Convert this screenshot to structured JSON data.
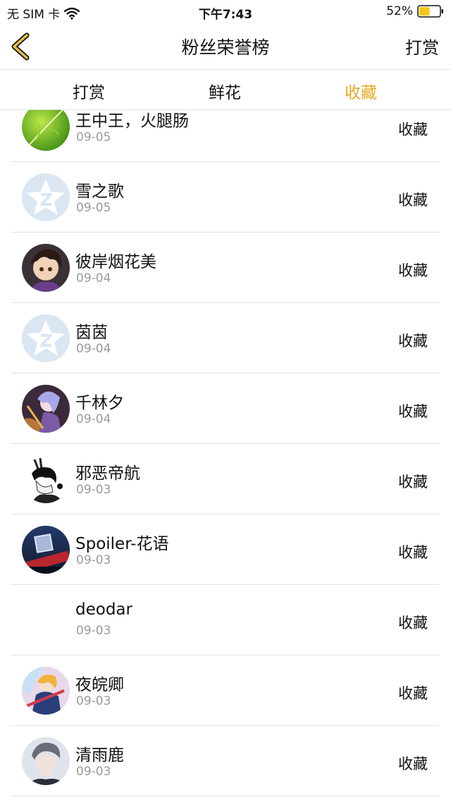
{
  "status_bar": {
    "carrier": "无 SIM 卡",
    "time": "下午7:43",
    "battery": "52%",
    "battery_level": 0.52,
    "battery_color": "#f5c518"
  },
  "nav": {
    "back_icon": "chevron-left-icon",
    "title": "粉丝荣誉榜",
    "action": "打赏",
    "accent_color": "#e6a823"
  },
  "tabs": [
    {
      "label": "打赏",
      "active": false
    },
    {
      "label": "鲜花",
      "active": false
    },
    {
      "label": "收藏",
      "active": true
    }
  ],
  "active_tab_color": "#e6a823",
  "entries": [
    {
      "name": "王中王，火腿肠",
      "date": "09-05",
      "action": "收藏",
      "avatar": "leaf"
    },
    {
      "name": "雪之歌",
      "date": "09-05",
      "action": "收藏",
      "avatar": "default"
    },
    {
      "name": "彼岸烟花美",
      "date": "09-04",
      "action": "收藏",
      "avatar": "anime-dark"
    },
    {
      "name": "茵茵",
      "date": "09-04",
      "action": "收藏",
      "avatar": "default"
    },
    {
      "name": "千林夕",
      "date": "09-04",
      "action": "收藏",
      "avatar": "anime-purple"
    },
    {
      "name": "邪恶帝航",
      "date": "09-03",
      "action": "收藏",
      "avatar": "sketch"
    },
    {
      "name": "Spoiler-花语",
      "date": "09-03",
      "action": "收藏",
      "avatar": "night"
    },
    {
      "name": "deodar",
      "date": "09-03",
      "action": "收藏",
      "avatar": "none"
    },
    {
      "name": "夜皖卿",
      "date": "09-03",
      "action": "收藏",
      "avatar": "anime-color"
    },
    {
      "name": "清雨鹿",
      "date": "09-03",
      "action": "收藏",
      "avatar": "portrait"
    }
  ]
}
